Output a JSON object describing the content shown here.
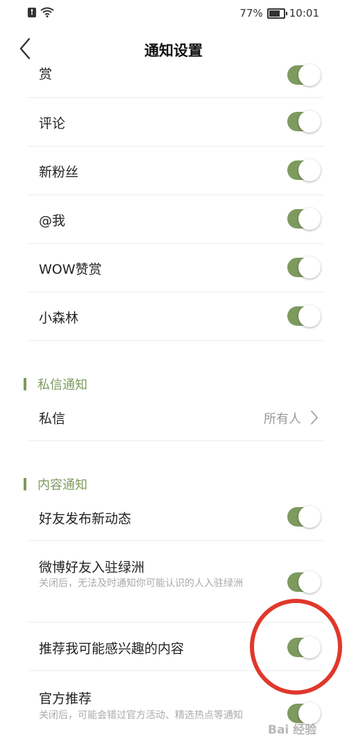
{
  "status": {
    "battery": "77%",
    "time": "10:01"
  },
  "nav": {
    "title": "通知设置"
  },
  "rows": [
    {
      "label": "赏",
      "on": true
    },
    {
      "label": "评论",
      "on": true
    },
    {
      "label": "新粉丝",
      "on": true
    },
    {
      "label": "@我",
      "on": true
    },
    {
      "label": "WOW赞赏",
      "on": true
    },
    {
      "label": "小森林",
      "on": true
    }
  ],
  "private": {
    "section_title": "私信通知",
    "label": "私信",
    "value": "所有人"
  },
  "content": {
    "section_title": "内容通知",
    "items": [
      {
        "label": "好友发布新动态",
        "on": true
      },
      {
        "label": "微博好友入驻绿洲",
        "sub": "关闭后，无法及时通知你可能认识的人入驻绿洲",
        "on": true
      },
      {
        "label": "推荐我可能感兴趣的内容",
        "on": true
      },
      {
        "label": "官方推荐",
        "sub": "关闭后，可能会错过官方活动、精选热点等通知",
        "on": true
      }
    ]
  },
  "watermark": "Bai 经验",
  "colors": {
    "accent": "#7e9a5f",
    "highlight": "#e0382c"
  }
}
